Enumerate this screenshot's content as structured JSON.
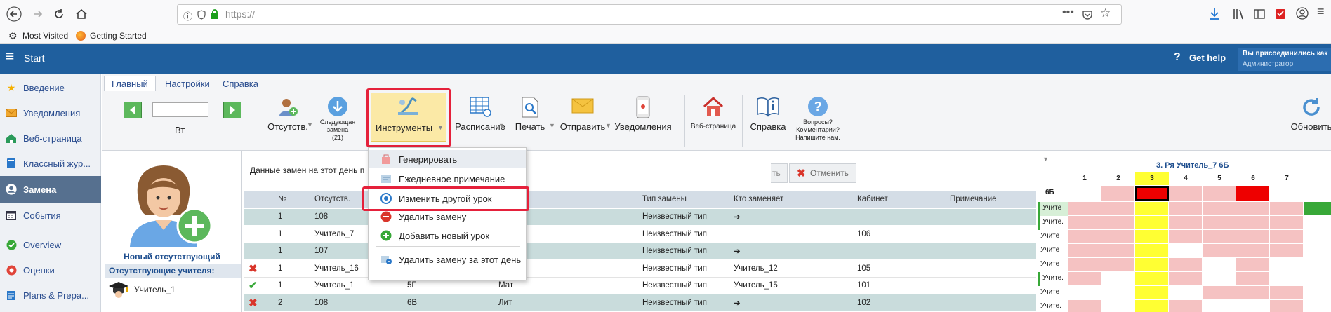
{
  "browser": {
    "url": "https://",
    "bookmarks": [
      "Most Visited",
      "Getting Started"
    ]
  },
  "app": {
    "menu_label": "Start",
    "help_label": "Get help",
    "user_line1": "Вы присоединились как",
    "user_line2": "Администратор"
  },
  "nav": {
    "items": [
      {
        "label": "Введение",
        "icon": "star-icon"
      },
      {
        "label": "Уведомления",
        "icon": "envelope-icon"
      },
      {
        "label": "Веб-страница",
        "icon": "house-icon"
      },
      {
        "label": "Классный жур...",
        "icon": "book-icon"
      },
      {
        "label": "Замена",
        "icon": "person-icon"
      },
      {
        "label": "События",
        "icon": "calendar-icon"
      },
      {
        "label": "Overview",
        "icon": "check-circle-icon"
      },
      {
        "label": "Оценки",
        "icon": "grades-icon"
      },
      {
        "label": "Plans & Prepa...",
        "icon": "plans-icon"
      }
    ]
  },
  "ribbon": {
    "tabs": [
      "Главный",
      "Настройки",
      "Справка"
    ],
    "day_label": "Вт",
    "buttons": {
      "absences": "Отсутств.",
      "next_sub_1": "Следующая",
      "next_sub_2": "замена",
      "next_sub_3": "(21)",
      "tools": "Инструменты",
      "schedule": "Расписание",
      "print": "Печать",
      "send": "Отправить",
      "notifications": "Уведомления",
      "webpage": "Веб-страница",
      "help": "Справка",
      "questions_1": "Вопросы?",
      "questions_2": "Комментарии?",
      "questions_3": "Напишите нам.",
      "refresh": "Обновить"
    }
  },
  "absent": {
    "new_label": "Новый отсутствующий",
    "section_label": "Отсутствующие учителя:",
    "teacher": "Учитель_1"
  },
  "content": {
    "title": "Данные замен на этот день п",
    "btn_partial": "ть",
    "cancel_label": "Отменить",
    "columns": [
      "№",
      "Отсутств.",
      "Тип замены",
      "Кто заменяет",
      "Кабинет",
      "Примечание"
    ],
    "rows": [
      {
        "num": "1",
        "absent": "108",
        "class": "",
        "subject": "",
        "type": "Неизвестный тип",
        "who": "➔",
        "room": "",
        "status": ""
      },
      {
        "num": "1",
        "absent": "Учитель_7",
        "class": "",
        "subject": "",
        "type": "Неизвестный тип",
        "who": "",
        "room": "106",
        "status": ""
      },
      {
        "num": "1",
        "absent": "107",
        "class": "",
        "subject": "",
        "type": "Неизвестный тип",
        "who": "➔",
        "room": "",
        "status": ""
      },
      {
        "num": "1",
        "absent": "Учитель_16",
        "class": "",
        "subject": "",
        "type": "Неизвестный тип",
        "who": "Учитель_12",
        "room": "105",
        "status": "x"
      },
      {
        "num": "1",
        "absent": "Учитель_1",
        "class": "5Г",
        "subject": "Мат",
        "type": "Неизвестный тип",
        "who": "Учитель_15",
        "room": "101",
        "status": "check"
      },
      {
        "num": "2",
        "absent": "108",
        "class": "6В",
        "subject": "Лит",
        "type": "Неизвестный тип",
        "who": "➔",
        "room": "102",
        "status": "x"
      }
    ]
  },
  "menu": {
    "items": [
      "Генерировать",
      "Ежедневное примечание",
      "Изменить другой урок",
      "Удалить замену",
      "Добавить новый урок",
      "Удалить замену за этот день"
    ]
  },
  "right": {
    "title": "3. Ря Учитель_7 6Б",
    "cols": [
      "1",
      "2",
      "3",
      "4",
      "5",
      "6",
      "7"
    ],
    "class_label": "6Б",
    "row_label": "Учите",
    "row_label_short": "Учите."
  }
}
